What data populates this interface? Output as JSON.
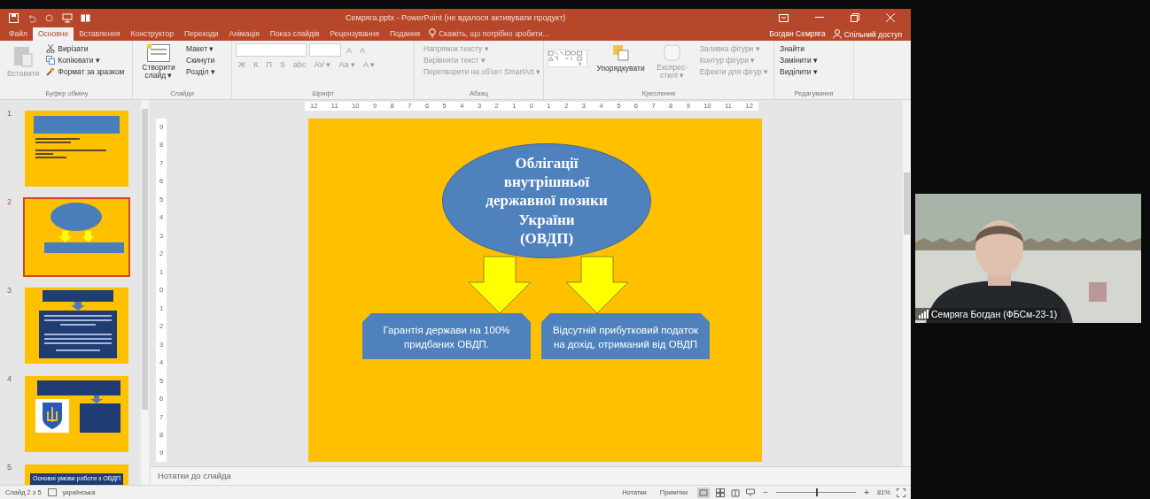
{
  "window": {
    "title": "Семряга.pptx - PowerPoint (не вдалося активувати продукт)"
  },
  "tabs": [
    {
      "label": "Файл",
      "selected": false
    },
    {
      "label": "Основне",
      "selected": true
    },
    {
      "label": "Вставлення",
      "selected": false
    },
    {
      "label": "Конструктор",
      "selected": false
    },
    {
      "label": "Переходи",
      "selected": false
    },
    {
      "label": "Анімація",
      "selected": false
    },
    {
      "label": "Показ слайдів",
      "selected": false
    },
    {
      "label": "Рецензування",
      "selected": false
    },
    {
      "label": "Подання",
      "selected": false
    }
  ],
  "tell_me": {
    "placeholder": "Скажіть, що потрібно зробити..."
  },
  "account": {
    "user": "Богдан Семряга",
    "share": "Спільний доступ"
  },
  "ribbon": {
    "clipboard": {
      "paste": "Вставити",
      "cut": "Вирізати",
      "copy": "Копіювати ▾",
      "format": "Формат за зразком",
      "label": "Буфер обміну"
    },
    "slides": {
      "new": "Створити слайд ▾",
      "layout": "Макет ▾",
      "reset": "Скинути",
      "section": "Розділ ▾",
      "label": "Слайди"
    },
    "font": {
      "row1": [
        "A",
        "A"
      ],
      "row2": [
        "Ж",
        "К",
        "П",
        "S",
        "abc",
        "AV ▾",
        "Aa ▾",
        "A ▾"
      ],
      "label": "Шрифт"
    },
    "paragraph": {
      "commands": [
        "Напрямок тексту ▾",
        "Вирівняти текст ▾",
        "Перетворити на об'єкт SmartArt ▾"
      ],
      "label": "Абзац"
    },
    "drawing": {
      "arrange": "Упорядкувати",
      "styles": "Експрес-стилі ▾",
      "commands": [
        "Заливка фігури ▾",
        "Контур фігури ▾",
        "Ефекти для фігур ▾"
      ],
      "label": "Креслення"
    },
    "editing": {
      "commands": [
        "Знайти",
        "Замінити ▾",
        "Виділити ▾"
      ],
      "label": "Редагування"
    }
  },
  "ruler": {
    "labels": [
      "12",
      "11",
      "10",
      "9",
      "8",
      "7",
      "6",
      "5",
      "4",
      "3",
      "2",
      "1",
      "0",
      "1",
      "2",
      "3",
      "4",
      "5",
      "6",
      "7",
      "8",
      "9",
      "10",
      "11",
      "12"
    ]
  },
  "vertical_ruler": {
    "labels": [
      "9",
      "8",
      "7",
      "6",
      "5",
      "4",
      "3",
      "2",
      "1",
      "0",
      "1",
      "2",
      "3",
      "4",
      "5",
      "6",
      "7",
      "8",
      "9"
    ]
  },
  "slides": [
    {
      "number": "1",
      "kind": "title",
      "selected": false
    },
    {
      "number": "2",
      "kind": "oval",
      "selected": true
    },
    {
      "number": "3",
      "kind": "text",
      "selected": false
    },
    {
      "number": "4",
      "kind": "emblem",
      "selected": false
    },
    {
      "number": "5",
      "kind": "heading",
      "selected": false,
      "title": "Основні умови роботи з ОВДП"
    }
  ],
  "slide": {
    "title_lines": [
      "Облігації",
      "внутрішньої",
      "державної позики",
      "України",
      "(ОВДП)"
    ],
    "boxes": [
      "Гарантія держави на 100% придбаних ОВДП.",
      "Відсутній прибутковий податок на дохід, отриманий від ОВДП"
    ]
  },
  "notes": {
    "placeholder": "Нотатки до слайда"
  },
  "status_bar": {
    "slide": "Слайд 2 з 5",
    "language": "українська",
    "notes": "Нотатки",
    "comments": "Примітки",
    "zoom_out": "−",
    "zoom_slider": {
      "level": 0.5
    },
    "zoom_in": "+",
    "zoom": "81%"
  },
  "participant": {
    "name": "Семряга Богдан (ФБСм-23-1)"
  }
}
